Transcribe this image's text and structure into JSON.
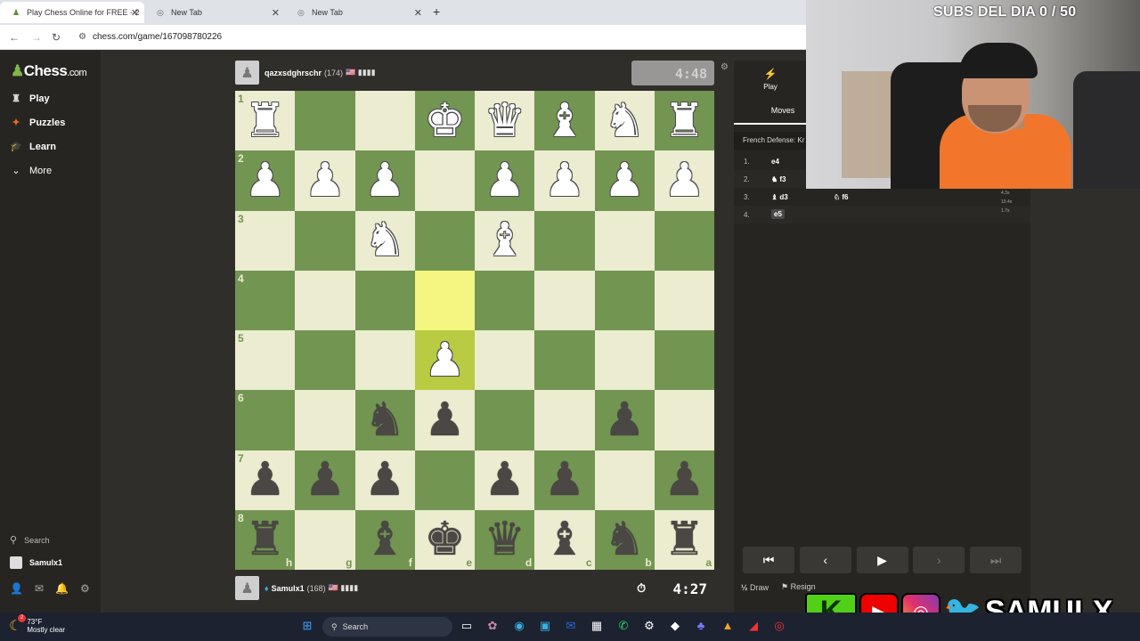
{
  "browser": {
    "tabs": [
      {
        "title": "Play Chess Online for FREE - 2",
        "active": true
      },
      {
        "title": "New Tab",
        "active": false
      },
      {
        "title": "New Tab",
        "active": false
      }
    ],
    "url": "chess.com/game/167098780226"
  },
  "sidebar": {
    "logo_main": "Chess",
    "logo_suffix": ".com",
    "items": [
      {
        "label": "Play",
        "icon": "play-icon"
      },
      {
        "label": "Puzzles",
        "icon": "puzzle-icon"
      },
      {
        "label": "Learn",
        "icon": "learn-icon"
      },
      {
        "label": "More",
        "icon": "chevron-down-icon"
      }
    ],
    "search_label": "Search",
    "user_label": "Samulx1"
  },
  "top_player": {
    "name": "qazxsdghrschr",
    "rating": "(174)",
    "flag": "🇺🇸 ▮▮▮▮",
    "clock": "4:48"
  },
  "bottom_player": {
    "name": "Samulx1",
    "rating": "(168)",
    "flag": "🇺🇸 ▮▮▮▮",
    "clock": "4:27"
  },
  "board": {
    "orientation": "black",
    "rank_labels": [
      "1",
      "2",
      "3",
      "4",
      "5",
      "6",
      "7",
      "8"
    ],
    "file_labels": [
      "h",
      "g",
      "f",
      "e",
      "d",
      "c",
      "b",
      "a"
    ],
    "rows": [
      [
        "wR",
        "",
        "",
        "wK",
        "wQ",
        "wB",
        "wN",
        "wR"
      ],
      [
        "wP",
        "wP",
        "wP",
        "",
        "wP",
        "wP",
        "wP",
        "wP"
      ],
      [
        "",
        "",
        "wN",
        "",
        "wB",
        "",
        "",
        ""
      ],
      [
        "",
        "",
        "",
        "",
        "",
        "",
        "",
        ""
      ],
      [
        "",
        "",
        "",
        "wP",
        "",
        "",
        "",
        ""
      ],
      [
        "",
        "",
        "bN",
        "bP",
        "",
        "",
        "bP",
        ""
      ],
      [
        "bP",
        "bP",
        "bP",
        "",
        "bP",
        "bP",
        "",
        "bP"
      ],
      [
        "bR",
        "",
        "bB",
        "bK",
        "bQ",
        "bB",
        "bN",
        "bR"
      ]
    ],
    "highlight": [
      [
        3,
        3
      ],
      [
        4,
        3
      ]
    ]
  },
  "panel": {
    "play_tab": "Play",
    "moves_tab": "Moves",
    "opening": "French Defense: Kr",
    "moves": [
      {
        "num": "1.",
        "white": "e4",
        "black": ""
      },
      {
        "num": "2.",
        "white": "♞ f3",
        "black": ""
      },
      {
        "num": "3.",
        "white": "♝ d3",
        "black": "♘ f6"
      },
      {
        "num": "4.",
        "white": "e5",
        "black": ""
      }
    ],
    "draw_label": "Draw",
    "draw_prefix": "½",
    "resign_label": "Resign"
  },
  "stream": {
    "subs_text": "SUBS DEL DIA 0 / 50",
    "social_k": "K",
    "social_name": "SAMULX",
    "side_stats": [
      "4.3s",
      "10.4s",
      "1.7s"
    ]
  },
  "taskbar": {
    "temp": "73°F",
    "condition": "Mostly clear",
    "notif_count": "2",
    "search": "Search"
  }
}
